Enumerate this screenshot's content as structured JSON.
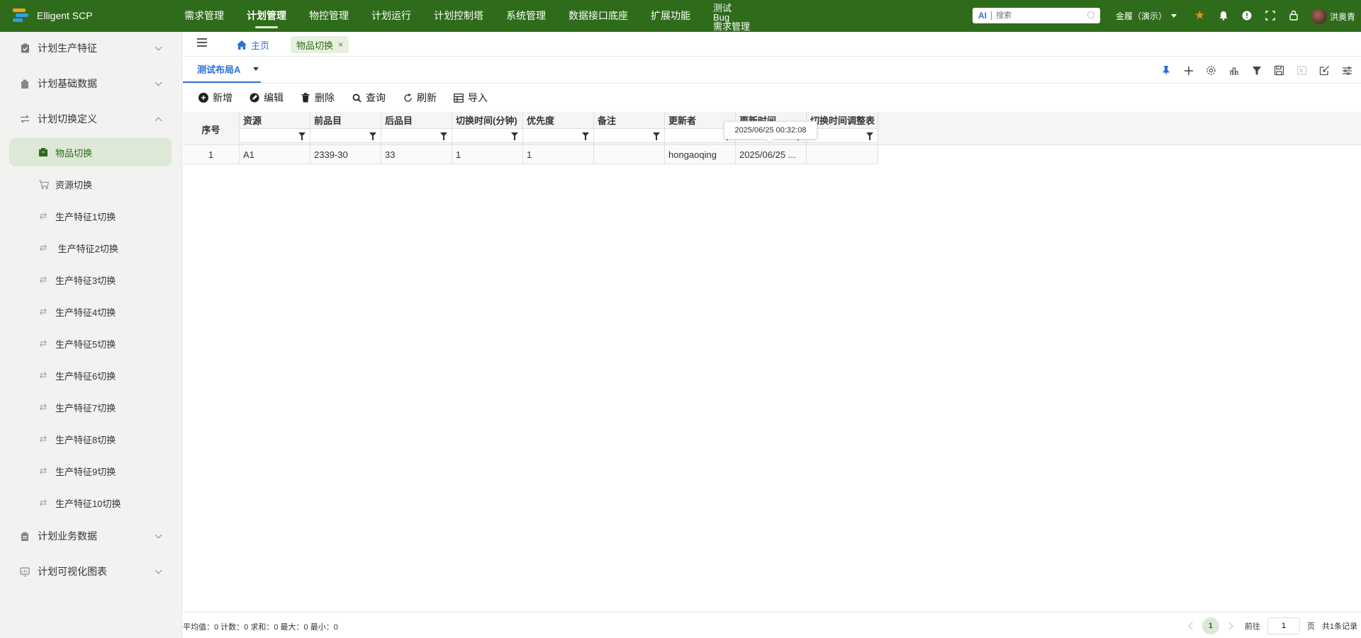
{
  "app": {
    "title": "Elligent SCP"
  },
  "topnav": [
    {
      "label": "需求管理",
      "active": false
    },
    {
      "label": "计划管理",
      "active": true
    },
    {
      "label": "物控管理",
      "active": false
    },
    {
      "label": "计划运行",
      "active": false
    },
    {
      "label": "计划控制塔",
      "active": false
    },
    {
      "label": "系统管理",
      "active": false
    },
    {
      "label": "数据接口底座",
      "active": false
    },
    {
      "label": "扩展功能",
      "active": false
    }
  ],
  "topnav_stacked": [
    "测试",
    "Bug",
    "需求管理"
  ],
  "search": {
    "ai_label": "AI",
    "placeholder": "搜索"
  },
  "org": {
    "label": "金履（演示）"
  },
  "user": {
    "name": "洪奥青"
  },
  "sidebar": {
    "groups": [
      {
        "label": "计划生产特征",
        "icon": "clipboard-check-icon",
        "expanded": false
      },
      {
        "label": "计划基础数据",
        "icon": "building-icon",
        "expanded": false
      },
      {
        "label": "计划切换定义",
        "icon": "swap-icon",
        "expanded": true
      },
      {
        "label": "计划业务数据",
        "icon": "clipboard-icon",
        "expanded": false
      },
      {
        "label": "计划可视化图表",
        "icon": "chart-icon",
        "expanded": false
      }
    ],
    "items": [
      {
        "label": "物品切换",
        "icon": "box-icon",
        "active": true
      },
      {
        "label": "资源切换",
        "icon": "cart-icon",
        "active": false
      },
      {
        "label": "生产特征1切换",
        "icon": "swap-icon",
        "active": false
      },
      {
        "label": " 生产特征2切换",
        "icon": "swap-icon",
        "active": false
      },
      {
        "label": "生产特征3切换",
        "icon": "swap-icon",
        "active": false
      },
      {
        "label": "生产特征4切换",
        "icon": "swap-icon",
        "active": false
      },
      {
        "label": "生产特征5切换",
        "icon": "swap-icon",
        "active": false
      },
      {
        "label": "生产特征6切换",
        "icon": "swap-icon",
        "active": false
      },
      {
        "label": "生产特征7切换",
        "icon": "swap-icon",
        "active": false
      },
      {
        "label": "生产特征8切换",
        "icon": "swap-icon",
        "active": false
      },
      {
        "label": "生产特征9切换",
        "icon": "swap-icon",
        "active": false
      },
      {
        "label": "生产特征10切换",
        "icon": "swap-icon",
        "active": false
      }
    ]
  },
  "tabs": {
    "home": "主页",
    "current": "物品切换",
    "close": "×"
  },
  "layout": {
    "tab": "测试布局A"
  },
  "toolbar": {
    "add": "新增",
    "edit": "编辑",
    "delete": "删除",
    "query": "查询",
    "refresh": "刷新",
    "import": "导入"
  },
  "grid": {
    "columns": [
      "序号",
      "资源",
      "前品目",
      "后品目",
      "切换时间(分钟)",
      "优先度",
      "备注",
      "更新者",
      "更新时间",
      "切换时间调整表"
    ],
    "rows": [
      [
        "1",
        "A1",
        "2339-30",
        "33",
        "1",
        "1",
        "",
        "hongaoqing",
        "2025/06/25 ...",
        ""
      ]
    ],
    "tooltip": "2025/06/25 00:32:08"
  },
  "footer": {
    "stats": "平均值：0 计数：0 求和：0 最大：0 最小：0",
    "page": "1",
    "goto_label": "前往",
    "goto_value": "1",
    "page_suffix": "页",
    "total": "共1条记录"
  },
  "colors": {
    "brand": "#2e6b1a",
    "accent": "#2f6fd6",
    "active_bg": "#dde8d6"
  }
}
